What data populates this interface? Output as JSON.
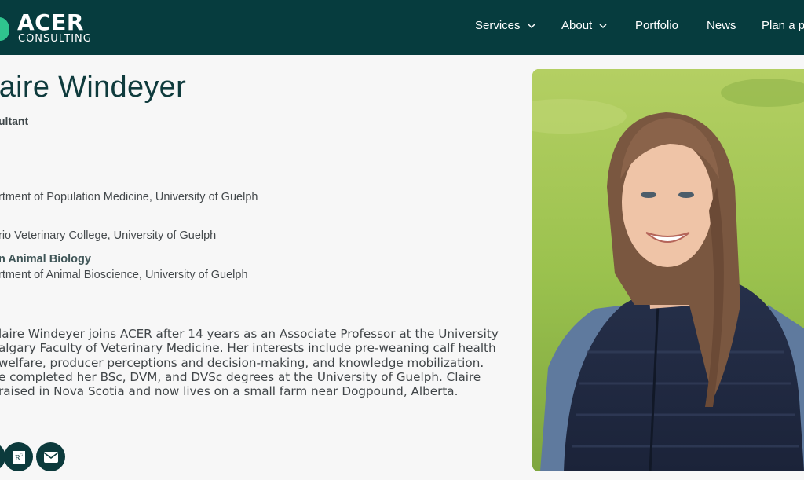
{
  "brand": {
    "title": "ACER",
    "subtitle": "CONSULTING",
    "color": "#063c3e",
    "accent": "#2fc48e"
  },
  "nav": {
    "items": [
      {
        "label": "Services",
        "has_dropdown": true
      },
      {
        "label": "About",
        "has_dropdown": true
      },
      {
        "label": "Portfolio",
        "has_dropdown": false
      },
      {
        "label": "News",
        "has_dropdown": false
      },
      {
        "label": "Plan a p",
        "has_dropdown": false
      }
    ]
  },
  "profile": {
    "name": "laire Windeyer",
    "role": "ultant",
    "education": [
      {
        "bold": "",
        "text": "rtment of Population Medicine, University of Guelph"
      },
      {
        "bold": "",
        "text": "rio Veterinary College, University of Guelph"
      },
      {
        "bold": "n Animal Biology",
        "text": "rtment of Animal Bioscience, University of Guelph"
      }
    ],
    "bio_lines": [
      "laire Windeyer joins ACER after 14 years as an Associate Professor at the University",
      "algary Faculty of Veterinary Medicine. Her interests include pre-weaning calf health",
      "welfare, producer perceptions and decision-making, and knowledge mobilization.",
      "e completed her BSc, DVM, and DVSc degrees at the University of Guelph. Claire",
      "raised in Nova Scotia and now lives on a small farm near Dogpound, Alberta."
    ],
    "social_icons": [
      "linkedin-icon",
      "researchgate-icon",
      "email-icon"
    ]
  }
}
